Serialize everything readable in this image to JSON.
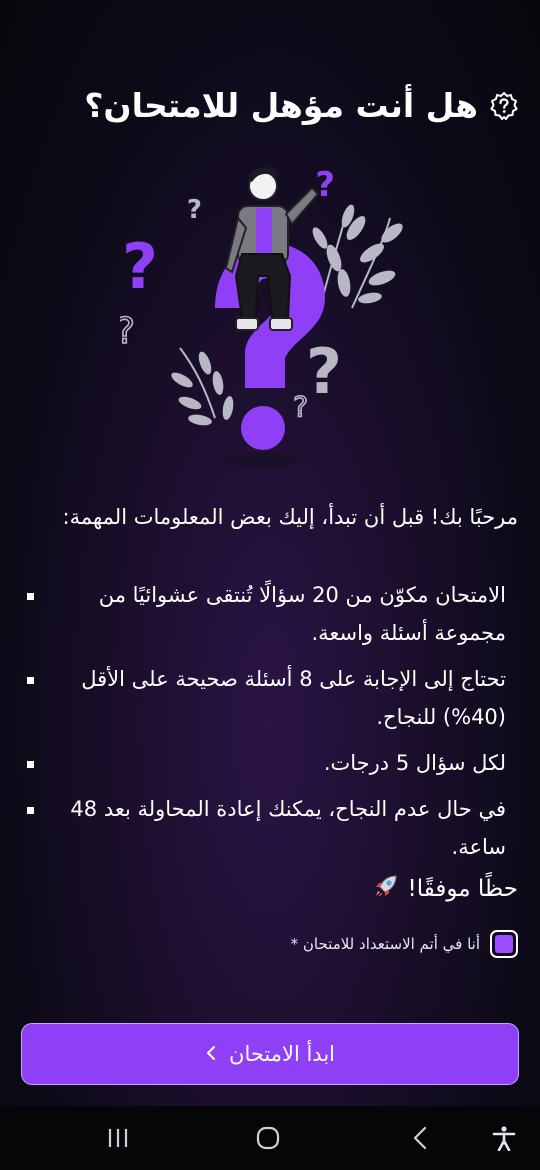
{
  "header": {
    "title": "هل أنت مؤهل للامتحان؟",
    "icon": "help-badge-icon"
  },
  "intro": "مرحبًا بك! قبل أن تبدأ، إليك بعض المعلومات المهمة:",
  "rules": [
    "الامتحان مكوّن من 20 سؤالًا تُنتقى عشوائيًا من مجموعة أسئلة واسعة.",
    "تحتاج إلى الإجابة على 8 أسئلة صحيحة على الأقل (40%) للنجاح.",
    "لكل سؤال 5 درجات.",
    "في حال عدم النجاح، يمكنك إعادة المحاولة بعد 48 ساعة."
  ],
  "good_luck": "حظًا موفقًا!",
  "good_luck_icon": "rocket-icon",
  "consent": {
    "label": "أنا في أتم الاستعداد للامتحان *",
    "checked": true
  },
  "start_button": {
    "label": "ابدأ الامتحان",
    "icon": "chevron-left-icon"
  },
  "system_nav": {
    "icons": [
      "accessibility-icon",
      "back-icon",
      "home-icon",
      "recents-icon"
    ]
  },
  "colors": {
    "accent": "#8f3ff5",
    "accent_light": "#9b4dff",
    "background": "#140d22"
  }
}
